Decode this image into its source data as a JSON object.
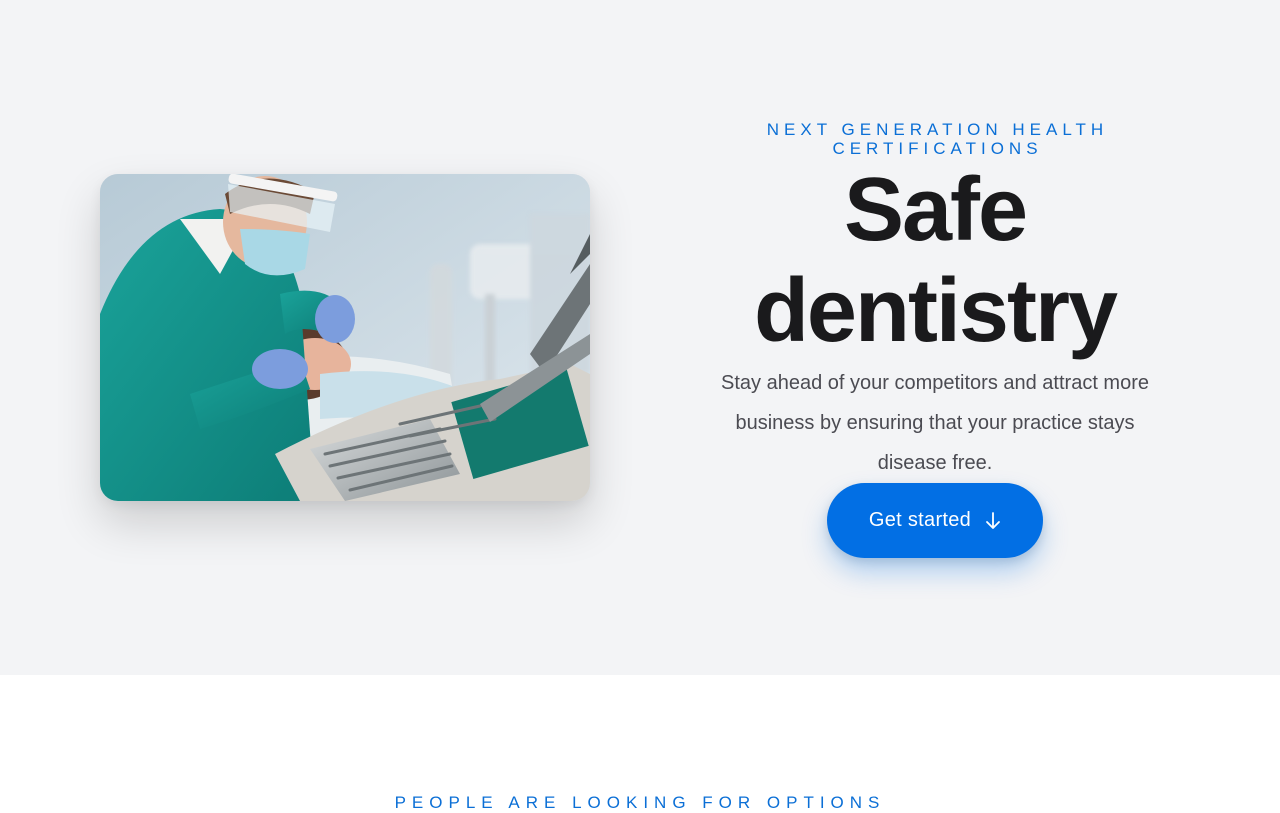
{
  "hero": {
    "eyebrow": "NEXT GENERATION HEALTH CERTIFICATIONS",
    "headline_line1": "Safe",
    "headline_line2": "dentistry",
    "subtext": "Stay ahead of your competitors and attract more business by ensuring that your practice stays disease free.",
    "cta_label": "Get started",
    "cta_icon": "arrow-down-icon",
    "image_subject": "dentist treating a patient",
    "accent_color": "#026fe4",
    "background_color": "#f3f4f6"
  },
  "next_section": {
    "eyebrow": "PEOPLE ARE LOOKING FOR OPTIONS"
  }
}
